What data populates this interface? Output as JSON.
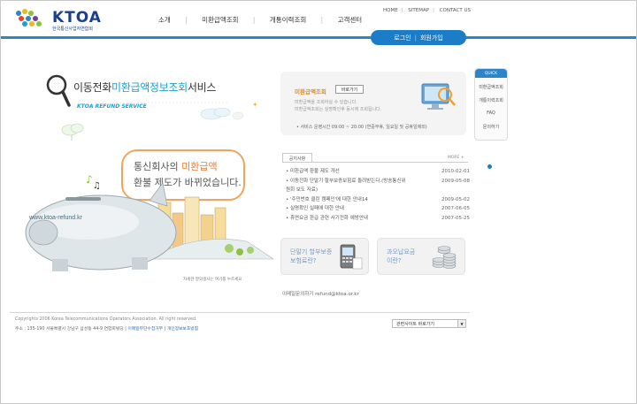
{
  "header": {
    "logo_text": "KTOA",
    "logo_subtitle": "한국통신사업자연합회",
    "top_links": [
      "HOME",
      "SITEMAP",
      "CONTACT US"
    ],
    "gnb": [
      "소개",
      "미환급액조회",
      "개통이력조회",
      "고객센터"
    ],
    "login_label": "로그인",
    "join_label": "회원가입"
  },
  "hero": {
    "title_prefix": "이동전화",
    "title_highlight": "미환급액정보조회",
    "title_suffix": "서비스",
    "subtitle": "KTOA REFUND SERVICE",
    "speech_prefix": "통신회사의 ",
    "speech_highlight": "미환급액",
    "speech_line2": "환불 제도가 바뀌었습니다.",
    "piggy_url": "www.ktoa-refund.kr",
    "note": "자세한 말의생사는 여기를 누르세요"
  },
  "service": {
    "title": "미환급액조회",
    "button": "바로가기",
    "desc1": "미환급액을 조회하실 수 있습니다.",
    "desc2": "미환급액조회는 실명확인후 동시에 조회됩니다.",
    "hours": "• 서비스 운영시간 09:00 ~ 20:00 (연중무휴, 일요일 및 공휴일제외)"
  },
  "notice": {
    "tab": "공지사항",
    "more": "MORE +",
    "items": [
      {
        "title": "• 미환급액 환불 제도 개선",
        "date": "2010-02-01"
      },
      {
        "title": "• 이동전화 단말기 할부보증보험료 돌려받는다.(방송통신위",
        "date": "2009-05-08"
      },
      {
        "title": "  원회 보도 자료)",
        "date": ""
      },
      {
        "title": "• '주민번호 클린 캠페인'에 대한 안내14",
        "date": "2009-05-02"
      },
      {
        "title": "• 실명확인 실패에 대한 안내",
        "date": "2007-06-05"
      },
      {
        "title": "• 휴면요금 환급 관련 사기전화 예방안내",
        "date": "2007-05-25"
      }
    ]
  },
  "banners": {
    "banner1_line1": "단말기 할부보증",
    "banner1_line2": "보험료란?",
    "banner2_line1": "과오납요금",
    "banner2_line2": "이란?"
  },
  "contact": "이메일문의하기 refund@ktoa.or.kr",
  "quick": {
    "head": "QUICK",
    "items": [
      "미환급액조회",
      "개통이력조회",
      "FAQ",
      "문의하기"
    ]
  },
  "footer": {
    "copyright": "Copyrights 2006 Korea Telecommunications Operators Association. All right reserved.",
    "address": "주소 : 135-190 서울특별시 강남구 삼성동 44-9 연합회빌딩",
    "link1": "이메일무단수집거부",
    "link2": "개인정보보호방침",
    "related_label": "관련사이트 바로가기"
  },
  "colors": {
    "brand_blue": "#1b7cc8",
    "accent_orange": "#ee7d2f",
    "highlight_cyan": "#1a9fd8"
  }
}
